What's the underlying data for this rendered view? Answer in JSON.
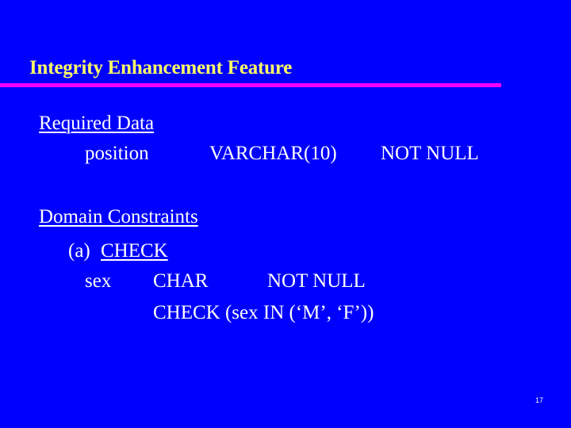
{
  "slide": {
    "title": "Integrity Enhancement Feature",
    "colors": {
      "background": "#0000ff",
      "title": "#ffff66",
      "rule": "#ff00ff",
      "text": "#ffffff"
    },
    "required_data": {
      "heading": "Required Data",
      "column": "position",
      "type": "VARCHAR(10)",
      "constraint": "NOT NULL"
    },
    "domain_constraints": {
      "heading": "Domain Constraints",
      "item_label": "(a)",
      "item_heading": "CHECK",
      "column": "sex",
      "type": "CHAR",
      "constraint": "NOT NULL",
      "check_clause": "CHECK (sex IN (‘M’, ‘F’))"
    },
    "page_number": "17"
  }
}
